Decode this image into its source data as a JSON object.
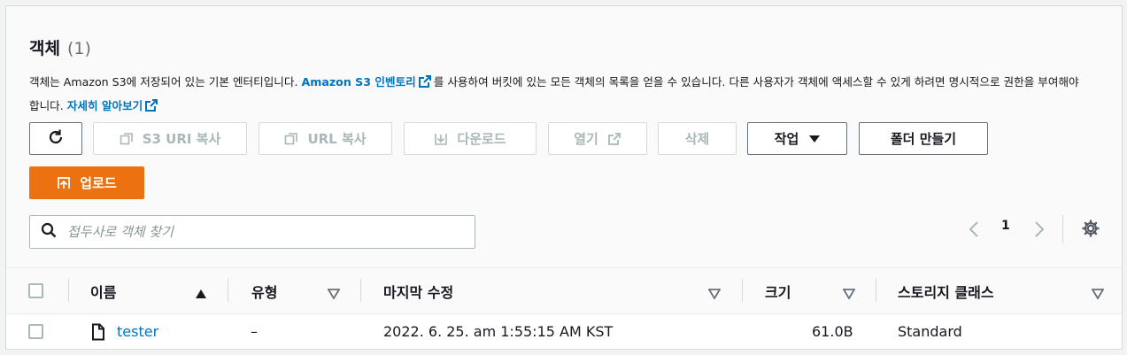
{
  "header": {
    "title": "객체",
    "count": "(1)"
  },
  "description": {
    "part1": "객체는 Amazon S3에 저장되어 있는 기본 엔터티입니다. ",
    "inventory_link": "Amazon S3 인벤토리",
    "part2": "를 사용하여 버킷에 있는 모든 객체의 목록을 얻을 수 있습니다. 다른 사용자가 객체에 액세스할 수 있게 하려면 명시적으로 권한을 부여해야 합니다. ",
    "learn_more_link": "자세히 알아보기"
  },
  "toolbar": {
    "refresh_icon": "refresh-icon",
    "copy_s3_uri": "S3 URI 복사",
    "copy_url": "URL 복사",
    "download": "다운로드",
    "open": "열기",
    "delete": "삭제",
    "actions": "작업",
    "create_folder": "폴더 만들기",
    "upload": "업로드"
  },
  "search": {
    "placeholder": "접두사로 객체 찾기",
    "value": ""
  },
  "pagination": {
    "current_page": "1"
  },
  "table": {
    "columns": [
      "이름",
      "유형",
      "마지막 수정",
      "크기",
      "스토리지 클래스"
    ],
    "rows": [
      {
        "name": "tester",
        "type": "–",
        "last_modified": "2022. 6. 25. am 1:55:15 AM KST",
        "size": "61.0B",
        "storage_class": "Standard"
      }
    ]
  },
  "colors": {
    "accent": "#ec7211",
    "link": "#0073bb",
    "disabled": "#aab7b8"
  }
}
